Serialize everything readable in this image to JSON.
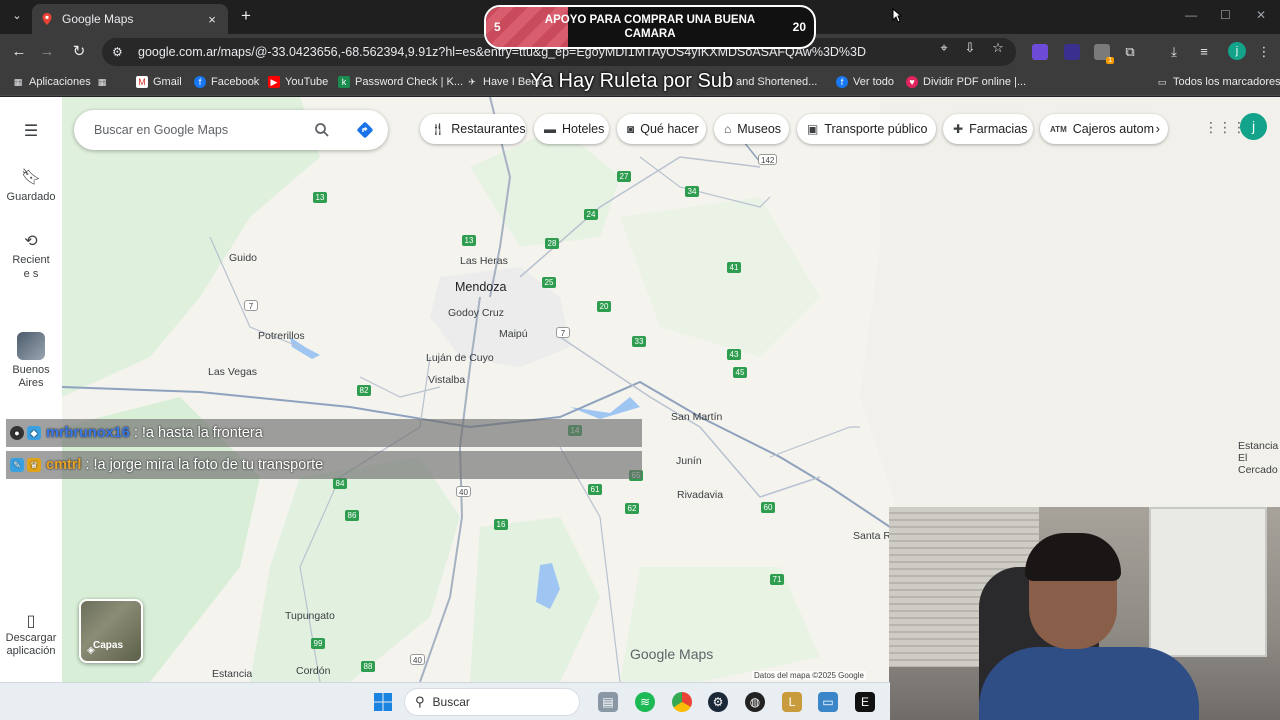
{
  "browser": {
    "tab_title": "Google Maps",
    "tab_close": "×",
    "new_tab": "+",
    "url": "google.com.ar/maps/@-33.0423656,-68.562394,9.91z?hl=es&entry=ttu&g_ep=EgoyMDI1MTAyOS4yIKXMDSoASAFQAw%3D%3D",
    "profile_initial": "j",
    "ext_badge": "1"
  },
  "bookmarks": [
    {
      "label": "Aplicaciones",
      "icon": "apps-grid-icon"
    },
    {
      "label": "Gmail",
      "icon": "gmail-icon"
    },
    {
      "label": "Facebook",
      "icon": "facebook-icon"
    },
    {
      "label": "YouTube",
      "icon": "youtube-icon"
    },
    {
      "label": "Password Check | K...",
      "icon": "key-icon"
    },
    {
      "label": "Have I Been",
      "icon": "bookmark-icon"
    },
    {
      "label": "and Shortened...",
      "icon": "link-icon"
    },
    {
      "label": "Ver todo",
      "icon": "facebook-icon"
    },
    {
      "label": "Dividir PDF online |...",
      "icon": "pdf-icon"
    },
    {
      "label": "Todos los marcadores",
      "icon": "folder-icon"
    }
  ],
  "overlay": {
    "alert_left_num": "5",
    "alert_text": "APOYO PARA COMPRAR UNA BUENA CAMARA",
    "alert_right_num": "20",
    "ruleta_text": "Ya Hay Ruleta por Sub"
  },
  "maps": {
    "search_placeholder": "Buscar en Google Maps",
    "rail": {
      "saved": "Guardado",
      "recent": "Reciente s",
      "buenos_aires": "Buenos Aires",
      "download": "Descargar aplicación"
    },
    "chips": [
      {
        "label": "Restaurantes",
        "icon": "fork-knife-icon"
      },
      {
        "label": "Hoteles",
        "icon": "bed-icon"
      },
      {
        "label": "Qué hacer",
        "icon": "camera-icon"
      },
      {
        "label": "Museos",
        "icon": "museum-icon"
      },
      {
        "label": "Transporte público",
        "icon": "train-icon"
      },
      {
        "label": "Farmacias",
        "icon": "pharmacy-icon"
      },
      {
        "label": "Cajeros autom",
        "icon": "atm-icon"
      }
    ],
    "account_initial": "j",
    "layers_label": "Capas",
    "brand": "Google Maps",
    "attribution": "Datos del mapa ©2025 Google",
    "cities": [
      {
        "name": "Mendoza",
        "big": true
      },
      {
        "name": "Guido"
      },
      {
        "name": "Las Heras"
      },
      {
        "name": "Godoy Cruz"
      },
      {
        "name": "Maipú"
      },
      {
        "name": "Potrerillos"
      },
      {
        "name": "Luján de Cuyo"
      },
      {
        "name": "Las Vegas"
      },
      {
        "name": "Vistalba"
      },
      {
        "name": "San Martín"
      },
      {
        "name": "Junín"
      },
      {
        "name": "Rivadavia"
      },
      {
        "name": "Santa Ro"
      },
      {
        "name": "Tupungato"
      },
      {
        "name": "Estancia"
      },
      {
        "name": "Cordón"
      },
      {
        "name": "Estancia El Cercado"
      }
    ],
    "routes": [
      "13",
      "13",
      "27",
      "34",
      "142",
      "24",
      "28",
      "25",
      "41",
      "20",
      "7",
      "7",
      "33",
      "43",
      "45",
      "82",
      "14",
      "65",
      "61",
      "84",
      "86",
      "40",
      "16",
      "62",
      "60",
      "71",
      "99",
      "88",
      "40"
    ]
  },
  "chat": [
    {
      "user": "mrbrunox16",
      "message": ": !a hasta la frontera"
    },
    {
      "user": "cmtrl",
      "message": ": !a jorge mira la foto de tu transporte"
    }
  ],
  "taskbar": {
    "search_label": "Buscar"
  },
  "colors": {
    "map_bg": "#f4f3ee",
    "green_area": "#d4ecd4",
    "route_shield": "#2e9d4f",
    "accent_teal": "#12a38a"
  }
}
